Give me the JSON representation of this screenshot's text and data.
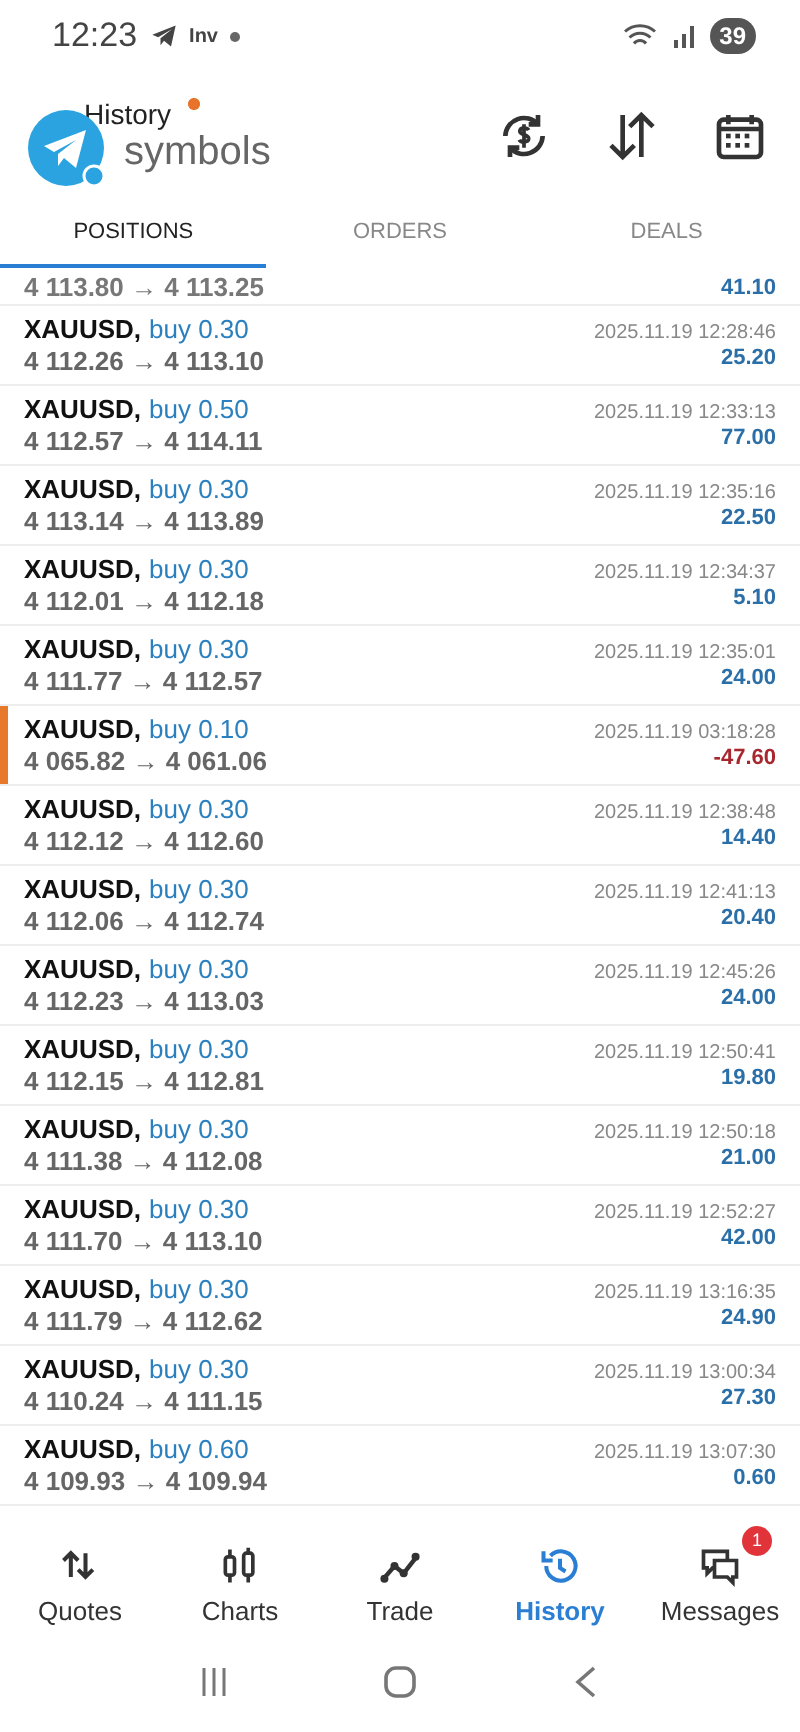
{
  "status_bar": {
    "time": "12:23",
    "app_label": "Inv",
    "battery": "39"
  },
  "header": {
    "title": "History",
    "subtitle": "symbols"
  },
  "tabs": [
    {
      "label": "POSITIONS",
      "selected": true
    },
    {
      "label": "ORDERS",
      "selected": false
    },
    {
      "label": "DEALS",
      "selected": false
    }
  ],
  "partial_row": {
    "prices": "4 113.80 → 4 113.25",
    "profit": "41.10"
  },
  "rows": [
    {
      "symbol": "XAUUSD,",
      "side": "buy 0.30",
      "prices": "4 112.26 → 4 113.10",
      "time": "2025.11.19 12:28:46",
      "profit": "25.20",
      "loss": false,
      "highlighted": false
    },
    {
      "symbol": "XAUUSD,",
      "side": "buy 0.50",
      "prices": "4 112.57 → 4 114.11",
      "time": "2025.11.19 12:33:13",
      "profit": "77.00",
      "loss": false,
      "highlighted": false
    },
    {
      "symbol": "XAUUSD,",
      "side": "buy 0.30",
      "prices": "4 113.14 → 4 113.89",
      "time": "2025.11.19 12:35:16",
      "profit": "22.50",
      "loss": false,
      "highlighted": false
    },
    {
      "symbol": "XAUUSD,",
      "side": "buy 0.30",
      "prices": "4 112.01 → 4 112.18",
      "time": "2025.11.19 12:34:37",
      "profit": "5.10",
      "loss": false,
      "highlighted": false
    },
    {
      "symbol": "XAUUSD,",
      "side": "buy 0.30",
      "prices": "4 111.77 → 4 112.57",
      "time": "2025.11.19 12:35:01",
      "profit": "24.00",
      "loss": false,
      "highlighted": false
    },
    {
      "symbol": "XAUUSD,",
      "side": "buy 0.10",
      "prices": "4 065.82 → 4 061.06",
      "time": "2025.11.19 03:18:28",
      "profit": "-47.60",
      "loss": true,
      "highlighted": true
    },
    {
      "symbol": "XAUUSD,",
      "side": "buy 0.30",
      "prices": "4 112.12 → 4 112.60",
      "time": "2025.11.19 12:38:48",
      "profit": "14.40",
      "loss": false,
      "highlighted": false
    },
    {
      "symbol": "XAUUSD,",
      "side": "buy 0.30",
      "prices": "4 112.06 → 4 112.74",
      "time": "2025.11.19 12:41:13",
      "profit": "20.40",
      "loss": false,
      "highlighted": false
    },
    {
      "symbol": "XAUUSD,",
      "side": "buy 0.30",
      "prices": "4 112.23 → 4 113.03",
      "time": "2025.11.19 12:45:26",
      "profit": "24.00",
      "loss": false,
      "highlighted": false
    },
    {
      "symbol": "XAUUSD,",
      "side": "buy 0.30",
      "prices": "4 112.15 → 4 112.81",
      "time": "2025.11.19 12:50:41",
      "profit": "19.80",
      "loss": false,
      "highlighted": false
    },
    {
      "symbol": "XAUUSD,",
      "side": "buy 0.30",
      "prices": "4 111.38 → 4 112.08",
      "time": "2025.11.19 12:50:18",
      "profit": "21.00",
      "loss": false,
      "highlighted": false
    },
    {
      "symbol": "XAUUSD,",
      "side": "buy 0.30",
      "prices": "4 111.70 → 4 113.10",
      "time": "2025.11.19 12:52:27",
      "profit": "42.00",
      "loss": false,
      "highlighted": false
    },
    {
      "symbol": "XAUUSD,",
      "side": "buy 0.30",
      "prices": "4 111.79 → 4 112.62",
      "time": "2025.11.19 13:16:35",
      "profit": "24.90",
      "loss": false,
      "highlighted": false
    },
    {
      "symbol": "XAUUSD,",
      "side": "buy 0.30",
      "prices": "4 110.24 → 4 111.15",
      "time": "2025.11.19 13:00:34",
      "profit": "27.30",
      "loss": false,
      "highlighted": false
    },
    {
      "symbol": "XAUUSD,",
      "side": "buy 0.60",
      "prices": "4 109.93 → 4 109.94",
      "time": "2025.11.19 13:07:30",
      "profit": "0.60",
      "loss": false,
      "highlighted": false
    }
  ],
  "bottom_nav": [
    {
      "label": "Quotes",
      "kind": "quotes",
      "selected": false
    },
    {
      "label": "Charts",
      "kind": "charts",
      "selected": false
    },
    {
      "label": "Trade",
      "kind": "trade",
      "selected": false
    },
    {
      "label": "History",
      "kind": "history",
      "selected": true
    },
    {
      "label": "Messages",
      "kind": "messages",
      "selected": false,
      "badge": "1"
    }
  ]
}
